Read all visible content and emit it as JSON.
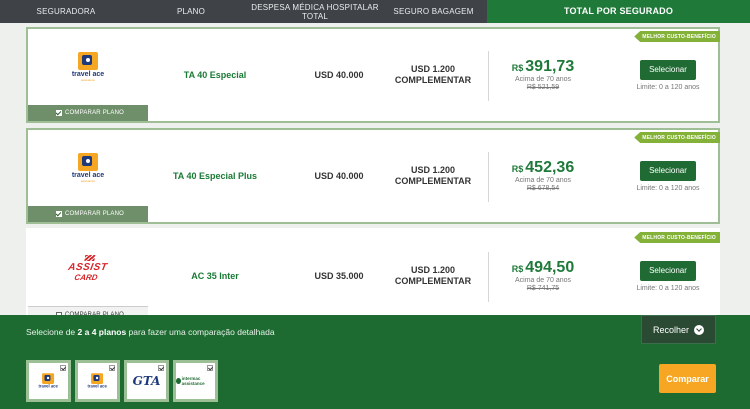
{
  "header": {
    "col_seguradora": "SEGURADORA",
    "col_plano": "PLANO",
    "col_despesa": "DESPESA MÉDICA HOSPITALAR TOTAL",
    "col_bagagem": "SEGURO BAGAGEM",
    "col_total": "TOTAL POR SEGURADO"
  },
  "rows": [
    {
      "insurer_logo": "travel-ace-logo",
      "insurer_logo_text": "travel ace",
      "insurer_logo_sub": "assistance",
      "plan": "TA 40 Especial",
      "hospital": "USD 40.000",
      "baggage_line1": "USD 1.200",
      "baggage_line2": "COMPLEMENTAR",
      "price_currency": "R$",
      "price": "391,73",
      "note": "Acima de 70 anos",
      "old_price": "R$ 521,59",
      "select": "Selecionar",
      "limit": "Limite: 0 a 120 anos",
      "badge": "MELHOR CUSTO-BENEFÍCIO",
      "compare": "COMPARAR PLANO",
      "compare_checked": true
    },
    {
      "insurer_logo": "travel-ace-logo",
      "insurer_logo_text": "travel ace",
      "insurer_logo_sub": "assistance",
      "plan": "TA 40 Especial Plus",
      "hospital": "USD 40.000",
      "baggage_line1": "USD 1.200",
      "baggage_line2": "COMPLEMENTAR",
      "price_currency": "R$",
      "price": "452,36",
      "note": "Acima de 70 anos",
      "old_price": "R$ 678,54",
      "select": "Selecionar",
      "limit": "Limite: 0 a 120 anos",
      "badge": "MELHOR CUSTO-BENEFÍCIO",
      "compare": "COMPARAR PLANO",
      "compare_checked": true
    },
    {
      "insurer_logo": "assist-card-logo",
      "insurer_logo_line1": "ASSIST",
      "insurer_logo_line2": "CARD",
      "plan": "AC 35 Inter",
      "hospital": "USD 35.000",
      "baggage_line1": "USD 1.200",
      "baggage_line2": "COMPLEMENTAR",
      "price_currency": "R$",
      "price": "494,50",
      "note": "Acima de 70 anos",
      "old_price": "R$ 741,75",
      "select": "Selecionar",
      "limit": "Limite: 0 a 120 anos",
      "badge": "MELHOR CUSTO-BENEFÍCIO",
      "compare": "COMPARAR PLANO",
      "compare_checked": false
    }
  ],
  "bottom": {
    "msg_prefix": "Selecione de ",
    "msg_bold": "2 a 4 planos",
    "msg_suffix": " para fazer uma comparação detalhada",
    "recolher": "Recolher",
    "comparar": "Comparar",
    "thumbs": [
      {
        "logo": "travel-ace-logo",
        "label": "travel ace"
      },
      {
        "logo": "travel-ace-logo",
        "label": "travel ace"
      },
      {
        "logo": "gta-logo",
        "label": "GTA"
      },
      {
        "logo": "intermac-logo",
        "label": "intermac assistance"
      }
    ]
  },
  "colors": {
    "header_bg": "#3f4347",
    "total_header_bg": "#1f7a3a",
    "accent_green": "#1f7a3a",
    "badge_green": "#84b238",
    "compare_orange": "#f6a623",
    "bottom_bg": "#1d6b31"
  }
}
